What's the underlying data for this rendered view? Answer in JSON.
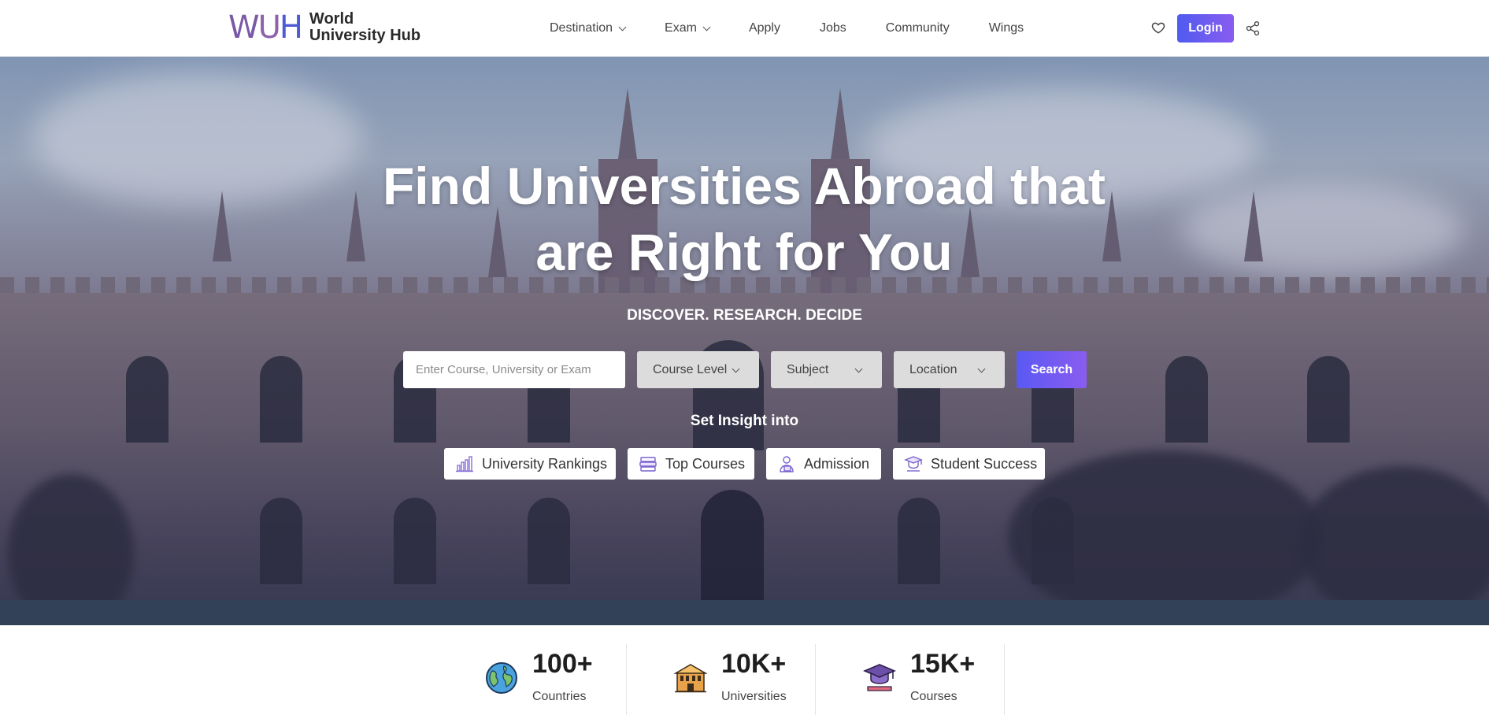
{
  "brand": {
    "mark_letters": [
      "W",
      "U",
      "H"
    ],
    "name_line1": "World",
    "name_line2": "University Hub"
  },
  "nav": {
    "items": [
      {
        "label": "Destination",
        "has_dropdown": true
      },
      {
        "label": "Exam",
        "has_dropdown": true
      },
      {
        "label": "Apply",
        "has_dropdown": false
      },
      {
        "label": "Jobs",
        "has_dropdown": false
      },
      {
        "label": "Community",
        "has_dropdown": false
      },
      {
        "label": "Wings",
        "has_dropdown": false
      }
    ],
    "login_label": "Login",
    "icons": [
      "heart-icon",
      "share-icon"
    ]
  },
  "hero": {
    "title": "Find Universities Abroad that are Right for You",
    "subtitle": "DISCOVER. RESEARCH. DECIDE",
    "search": {
      "placeholder": "Enter Course, University or Exam",
      "value": "",
      "course_level": "Course Level",
      "subject": "Subject",
      "location": "Location",
      "button_label": "Search"
    },
    "insight_title": "Set Insight into",
    "insights": [
      {
        "label": "University Rankings",
        "icon": "rankings-chart-icon"
      },
      {
        "label": "Top Courses",
        "icon": "books-icon"
      },
      {
        "label": "Admission",
        "icon": "admission-icon"
      },
      {
        "label": "Student Success",
        "icon": "graduate-icon"
      }
    ]
  },
  "stats": [
    {
      "value": "100+",
      "label": "Countries",
      "icon": "globe-icon"
    },
    {
      "value": "10K+",
      "label": "Universities",
      "icon": "university-building-icon"
    },
    {
      "value": "15K+",
      "label": "Courses",
      "icon": "graduation-cap-icon"
    }
  ],
  "colors": {
    "accent_start": "#4f5bf0",
    "accent_end": "#8a5cf0",
    "logo_purple": "#7a5aa6",
    "dropdown_bg": "#dcdcdc"
  }
}
